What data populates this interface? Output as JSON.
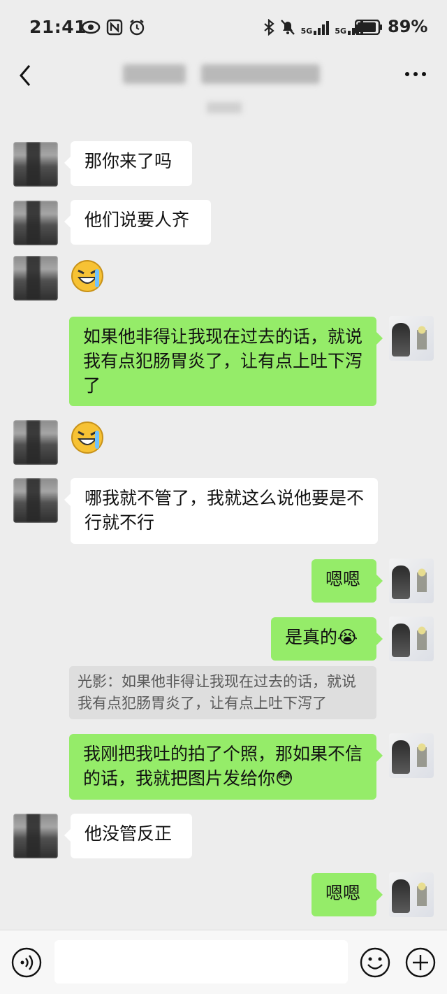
{
  "status_bar": {
    "time": "21:41",
    "network_1": "5G",
    "network_2": "5G",
    "battery_percent": "89%",
    "battery_level": 0.89
  },
  "nav": {
    "back_icon": "chevron-left-icon",
    "more_icon": "more-horizontal-icon"
  },
  "messages": [
    {
      "side": "other",
      "text": "那你来了吗"
    },
    {
      "side": "other",
      "text": "他们说要人齐"
    },
    {
      "side": "other",
      "emoji": "cry-laugh-sticker"
    },
    {
      "side": "self",
      "text": "如果他非得让我现在过去的话，就说我有点犯肠胃炎了，让有点上吐下泻了"
    },
    {
      "side": "other",
      "emoji": "cry-laugh-sticker"
    },
    {
      "side": "other",
      "text": "哪我就不管了，我就这么说他要是不行就不行"
    },
    {
      "side": "self",
      "text": "嗯嗯"
    },
    {
      "side": "self",
      "text": "是真的😭"
    },
    {
      "side": "self",
      "text": "我刚把我吐的拍了个照，那如果不信的话，我就把图片发给你😳"
    },
    {
      "side": "other",
      "text": "他没管反正"
    },
    {
      "side": "self",
      "text": "嗯嗯"
    }
  ],
  "quote": {
    "text": "光影：如果他非得让我现在过去的话，就说我有点犯肠胃炎了，让有点上吐下泻了"
  },
  "input_bar": {
    "voice_icon": "voice-icon",
    "emoji_icon": "emoji-icon",
    "plus_icon": "plus-icon",
    "input_value": ""
  },
  "colors": {
    "background": "#ededed",
    "self_bubble": "#95ec69",
    "other_bubble": "#ffffff",
    "quote_bg": "#dedede"
  }
}
